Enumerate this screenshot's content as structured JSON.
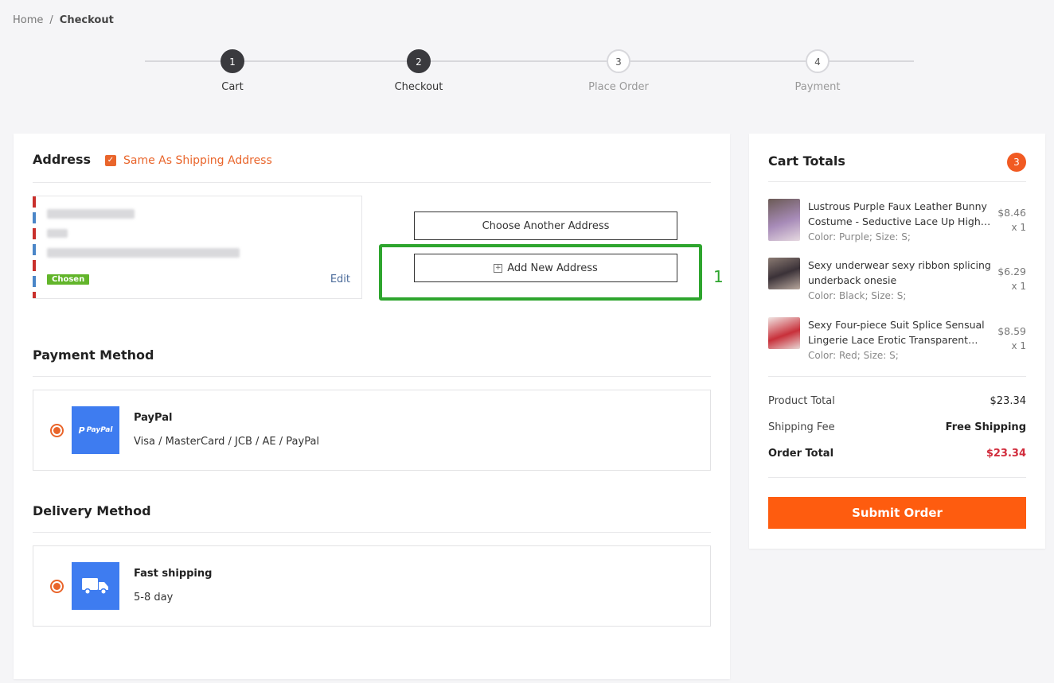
{
  "breadcrumb": {
    "home": "Home",
    "sep": "/",
    "current": "Checkout"
  },
  "steps": [
    {
      "num": "1",
      "label": "Cart",
      "done": true
    },
    {
      "num": "2",
      "label": "Checkout",
      "done": true
    },
    {
      "num": "3",
      "label": "Place Order",
      "done": false
    },
    {
      "num": "4",
      "label": "Payment",
      "done": false
    }
  ],
  "address": {
    "title": "Address",
    "same_as_shipping": "Same As Shipping Address",
    "chosen": "Chosen",
    "edit": "Edit",
    "choose_another": "Choose Another Address",
    "add_new": "Add New Address",
    "annotation": "1"
  },
  "payment": {
    "title": "Payment Method",
    "name": "PayPal",
    "logo_text": "PayPal",
    "methods": "Visa / MasterCard / JCB / AE / PayPal"
  },
  "delivery": {
    "title": "Delivery Method",
    "name": "Fast shipping",
    "time": "5-8 day"
  },
  "cart": {
    "title": "Cart Totals",
    "count": "3",
    "items": [
      {
        "name": "Lustrous Purple Faux Leather Bunny Costume - Seductive Lace Up High…",
        "attr": "Color: Purple; Size: S;",
        "price": "$8.46",
        "qty": "x 1",
        "color": "#a78bb8"
      },
      {
        "name": "Sexy underwear sexy ribbon splicing underback onesie",
        "attr": "Color: Black; Size: S;",
        "price": "$6.29",
        "qty": "x 1",
        "color": "#3b3238"
      },
      {
        "name": "Sexy Four-piece Suit Splice Sensual Lingerie Lace Erotic Transparent…",
        "attr": "Color: Red; Size: S;",
        "price": "$8.59",
        "qty": "x 1",
        "color": "#c8303a"
      }
    ],
    "product_total_label": "Product Total",
    "product_total": "$23.34",
    "shipping_label": "Shipping Fee",
    "shipping": "Free Shipping",
    "order_total_label": "Order Total",
    "order_total": "$23.34",
    "submit": "Submit Order"
  }
}
